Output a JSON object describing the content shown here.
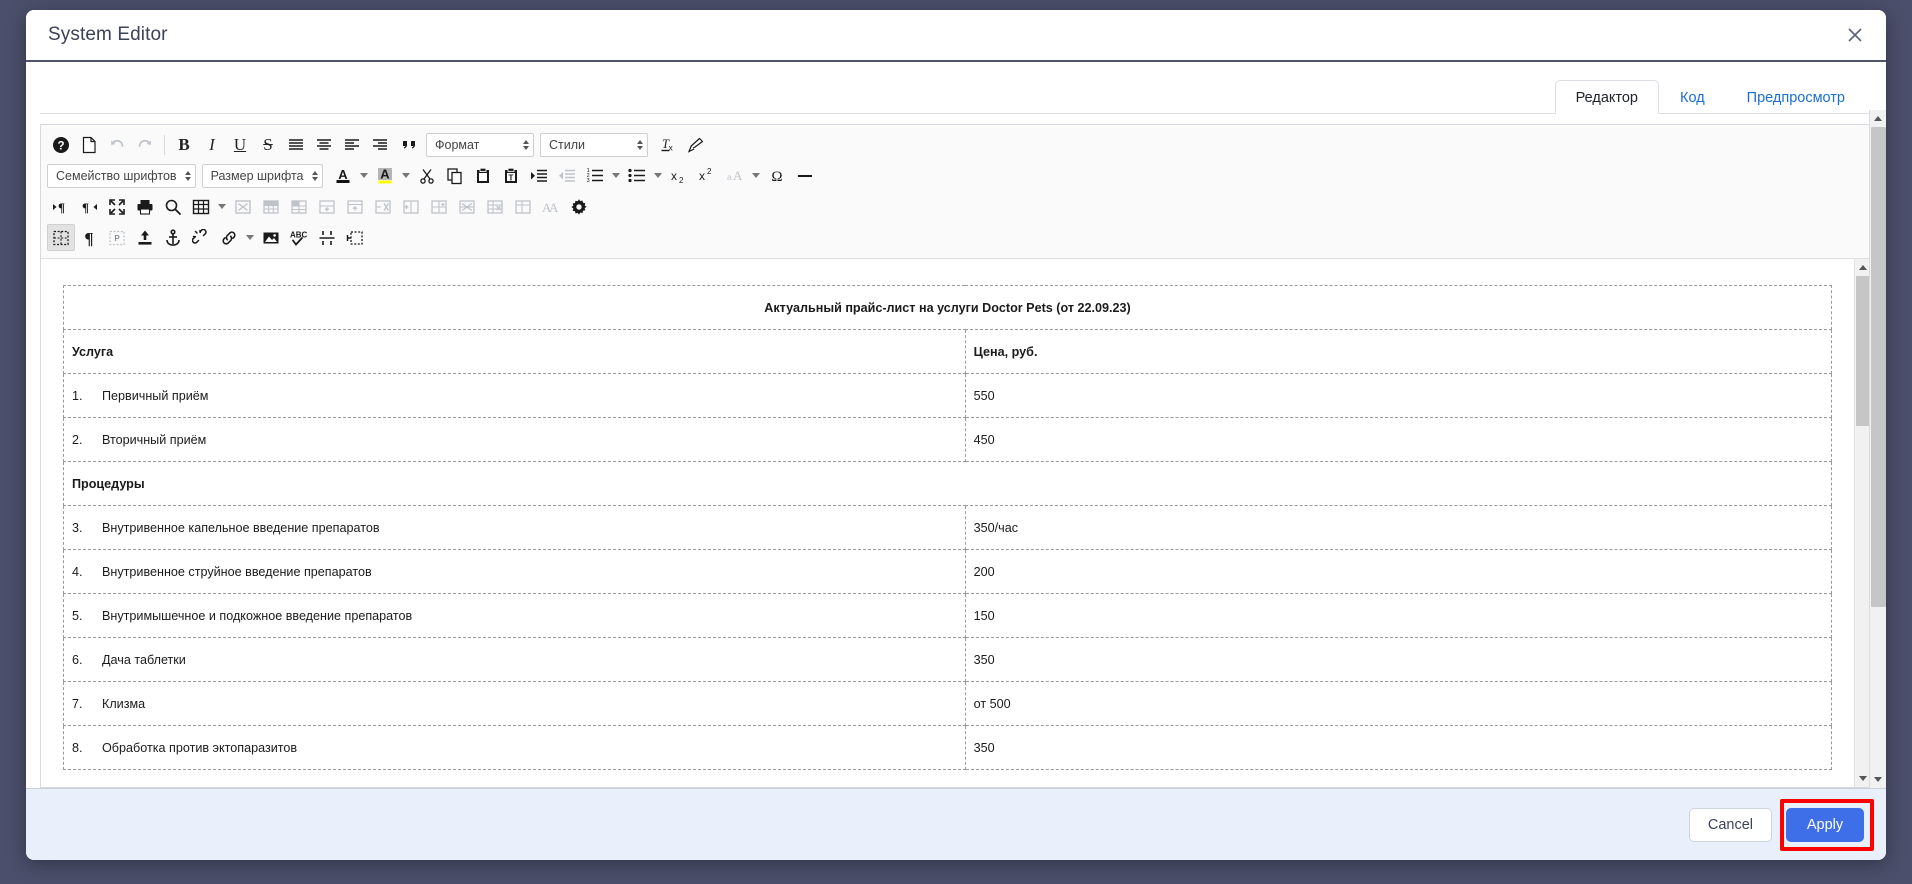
{
  "window": {
    "title": "System Editor",
    "close_icon": "close-icon"
  },
  "tabs": [
    {
      "label": "Редактор",
      "active": true
    },
    {
      "label": "Код",
      "active": false
    },
    {
      "label": "Предпросмотр",
      "active": false
    }
  ],
  "toolbar": {
    "rows": [
      {
        "name": "toolbar-row-1",
        "items": [
          {
            "type": "button",
            "name": "help-icon",
            "glyph": "?"
          },
          {
            "type": "button",
            "name": "new-page-icon",
            "glyph": "page"
          },
          {
            "type": "button",
            "name": "undo-icon",
            "glyph": "undo",
            "disabled": true
          },
          {
            "type": "button",
            "name": "redo-icon",
            "glyph": "redo",
            "disabled": true
          },
          {
            "type": "separator",
            "name": "toolbar-separator"
          },
          {
            "type": "button",
            "name": "bold-icon",
            "glyph": "B"
          },
          {
            "type": "button",
            "name": "italic-icon",
            "glyph": "I"
          },
          {
            "type": "button",
            "name": "underline-icon",
            "glyph": "U"
          },
          {
            "type": "button",
            "name": "strikethrough-icon",
            "glyph": "S"
          },
          {
            "type": "button",
            "name": "align-justify-icon",
            "glyph": "justify"
          },
          {
            "type": "button",
            "name": "align-center-icon",
            "glyph": "center"
          },
          {
            "type": "button",
            "name": "align-left-icon",
            "glyph": "left"
          },
          {
            "type": "button",
            "name": "align-right-icon",
            "glyph": "right"
          },
          {
            "type": "button",
            "name": "blockquote-icon",
            "glyph": "quote"
          },
          {
            "type": "select",
            "name": "format-select",
            "label": "Формат",
            "variant": "fmt"
          },
          {
            "type": "select",
            "name": "styles-select",
            "label": "Стили",
            "variant": "sty"
          },
          {
            "type": "button",
            "name": "remove-format-icon",
            "glyph": "Tx"
          },
          {
            "type": "button",
            "name": "copy-formatting-icon",
            "glyph": "broom"
          }
        ]
      },
      {
        "name": "toolbar-row-2",
        "items": [
          {
            "type": "select",
            "name": "font-family-select",
            "label": "Семейство шрифтов",
            "variant": "fam"
          },
          {
            "type": "select",
            "name": "font-size-select",
            "label": "Размер шрифта",
            "variant": "size"
          },
          {
            "type": "button",
            "name": "text-color-icon",
            "glyph": "A-color"
          },
          {
            "type": "arrow",
            "name": "text-color-dropdown-icon"
          },
          {
            "type": "button",
            "name": "background-color-icon",
            "glyph": "A-highlight"
          },
          {
            "type": "arrow",
            "name": "background-color-dropdown-icon"
          },
          {
            "type": "button",
            "name": "cut-icon",
            "glyph": "scissors"
          },
          {
            "type": "button",
            "name": "copy-icon",
            "glyph": "copy"
          },
          {
            "type": "button",
            "name": "paste-icon",
            "glyph": "paste"
          },
          {
            "type": "button",
            "name": "paste-as-text-icon",
            "glyph": "paste-text"
          },
          {
            "type": "button",
            "name": "increase-indent-icon",
            "glyph": "indent"
          },
          {
            "type": "button",
            "name": "decrease-indent-icon",
            "glyph": "outdent",
            "disabled": true
          },
          {
            "type": "button",
            "name": "numbered-list-icon",
            "glyph": "ol"
          },
          {
            "type": "arrow",
            "name": "numbered-list-dropdown-icon"
          },
          {
            "type": "button",
            "name": "bulleted-list-icon",
            "glyph": "ul"
          },
          {
            "type": "arrow",
            "name": "bulleted-list-dropdown-icon"
          },
          {
            "type": "button",
            "name": "subscript-icon",
            "glyph": "sub"
          },
          {
            "type": "button",
            "name": "superscript-icon",
            "glyph": "sup"
          },
          {
            "type": "button",
            "name": "text-transform-icon",
            "glyph": "aA",
            "disabled": true
          },
          {
            "type": "arrow",
            "name": "text-transform-dropdown-icon"
          },
          {
            "type": "button",
            "name": "special-character-icon",
            "glyph": "omega"
          },
          {
            "type": "button",
            "name": "horizontal-rule-icon",
            "glyph": "hr"
          }
        ]
      },
      {
        "name": "toolbar-row-3",
        "items": [
          {
            "type": "button",
            "name": "text-direction-ltr-icon",
            "glyph": "ltr"
          },
          {
            "type": "button",
            "name": "text-direction-rtl-icon",
            "glyph": "rtl"
          },
          {
            "type": "button",
            "name": "maximize-icon",
            "glyph": "maximize"
          },
          {
            "type": "button",
            "name": "print-icon",
            "glyph": "print"
          },
          {
            "type": "button",
            "name": "find-icon",
            "glyph": "search"
          },
          {
            "type": "button",
            "name": "insert-table-icon",
            "glyph": "table"
          },
          {
            "type": "arrow",
            "name": "insert-table-dropdown-icon"
          },
          {
            "type": "button",
            "name": "delete-table-icon",
            "glyph": "table-x",
            "disabled": true
          },
          {
            "type": "button",
            "name": "merge-cells-icon",
            "glyph": "table-merge",
            "disabled": true
          },
          {
            "type": "button",
            "name": "split-cell-icon",
            "glyph": "table-split",
            "disabled": true
          },
          {
            "type": "button",
            "name": "insert-row-below-icon",
            "glyph": "row-plus",
            "disabled": true
          },
          {
            "type": "button",
            "name": "insert-row-above-icon",
            "glyph": "row-plus2",
            "disabled": true
          },
          {
            "type": "button",
            "name": "insert-column-left-icon",
            "glyph": "col-plus",
            "disabled": true
          },
          {
            "type": "button",
            "name": "delete-row-icon",
            "glyph": "row-x",
            "disabled": true
          },
          {
            "type": "button",
            "name": "insert-column-right-icon",
            "glyph": "col-plus2",
            "disabled": true
          },
          {
            "type": "button",
            "name": "insert-column-icon",
            "glyph": "col-plus3",
            "disabled": true
          },
          {
            "type": "button",
            "name": "delete-cell-icon",
            "glyph": "cell-x",
            "disabled": true
          },
          {
            "type": "button",
            "name": "delete-column-icon",
            "glyph": "col-x",
            "disabled": true
          },
          {
            "type": "button",
            "name": "table-properties-icon",
            "glyph": "table-props",
            "disabled": true
          },
          {
            "type": "button",
            "name": "font-style-icon",
            "glyph": "AA",
            "disabled": true
          },
          {
            "type": "button",
            "name": "settings-gear-icon",
            "glyph": "gear"
          }
        ]
      },
      {
        "name": "toolbar-row-4",
        "items": [
          {
            "type": "button",
            "name": "show-blocks-icon",
            "glyph": "blocks",
            "active": true
          },
          {
            "type": "button",
            "name": "show-paragraph-marks-icon",
            "glyph": "pilcrow"
          },
          {
            "type": "button",
            "name": "insert-placeholder-icon",
            "glyph": "p-box",
            "disabled": true
          },
          {
            "type": "button",
            "name": "upload-file-icon",
            "glyph": "upload"
          },
          {
            "type": "button",
            "name": "anchor-icon",
            "glyph": "anchor"
          },
          {
            "type": "button",
            "name": "unlink-icon",
            "glyph": "unlink"
          },
          {
            "type": "button",
            "name": "link-icon",
            "glyph": "link"
          },
          {
            "type": "arrow",
            "name": "link-dropdown-icon"
          },
          {
            "type": "button",
            "name": "insert-image-icon",
            "glyph": "image"
          },
          {
            "type": "button",
            "name": "spell-check-icon",
            "glyph": "spell"
          },
          {
            "type": "button",
            "name": "page-break-icon",
            "glyph": "pagebreak"
          },
          {
            "type": "button",
            "name": "insert-div-icon",
            "glyph": "div"
          }
        ]
      }
    ]
  },
  "document": {
    "title_row": "Актуальный прайс-лист на услуги Doctor Pets (от 22.09.23)",
    "columns": [
      "Услуга",
      "Цена, руб."
    ],
    "rows": [
      {
        "kind": "item",
        "num": "1.",
        "service": "Первичный приём",
        "price": "550"
      },
      {
        "kind": "item",
        "num": "2.",
        "service": "Вторичный приём",
        "price": "450"
      },
      {
        "kind": "section",
        "num": "",
        "service": "Процедуры",
        "price": ""
      },
      {
        "kind": "item",
        "num": "3.",
        "service": "Внутривенное капельное введение препаратов",
        "price": "350/час"
      },
      {
        "kind": "item",
        "num": "4.",
        "service": "Внутривенное струйное введение препаратов",
        "price": "200"
      },
      {
        "kind": "item",
        "num": "5.",
        "service": "Внутримышечное и подкожное введение препаратов",
        "price": "150"
      },
      {
        "kind": "item",
        "num": "6.",
        "service": "Дача таблетки",
        "price": "350"
      },
      {
        "kind": "item",
        "num": "7.",
        "service": "Клизма",
        "price": "от 500"
      },
      {
        "kind": "item",
        "num": "8.",
        "service": "Обработка против эктопаразитов",
        "price": "350"
      }
    ]
  },
  "footer": {
    "cancel_label": "Cancel",
    "apply_label": "Apply"
  },
  "colors": {
    "backdrop": "#4b4f6b",
    "accent": "#3f6fe8",
    "footer_bg": "#eaf0fb",
    "tab_link": "#1a6fd4",
    "highlight_box": "#ff0000",
    "highlight_yellow": "#ffff00"
  }
}
